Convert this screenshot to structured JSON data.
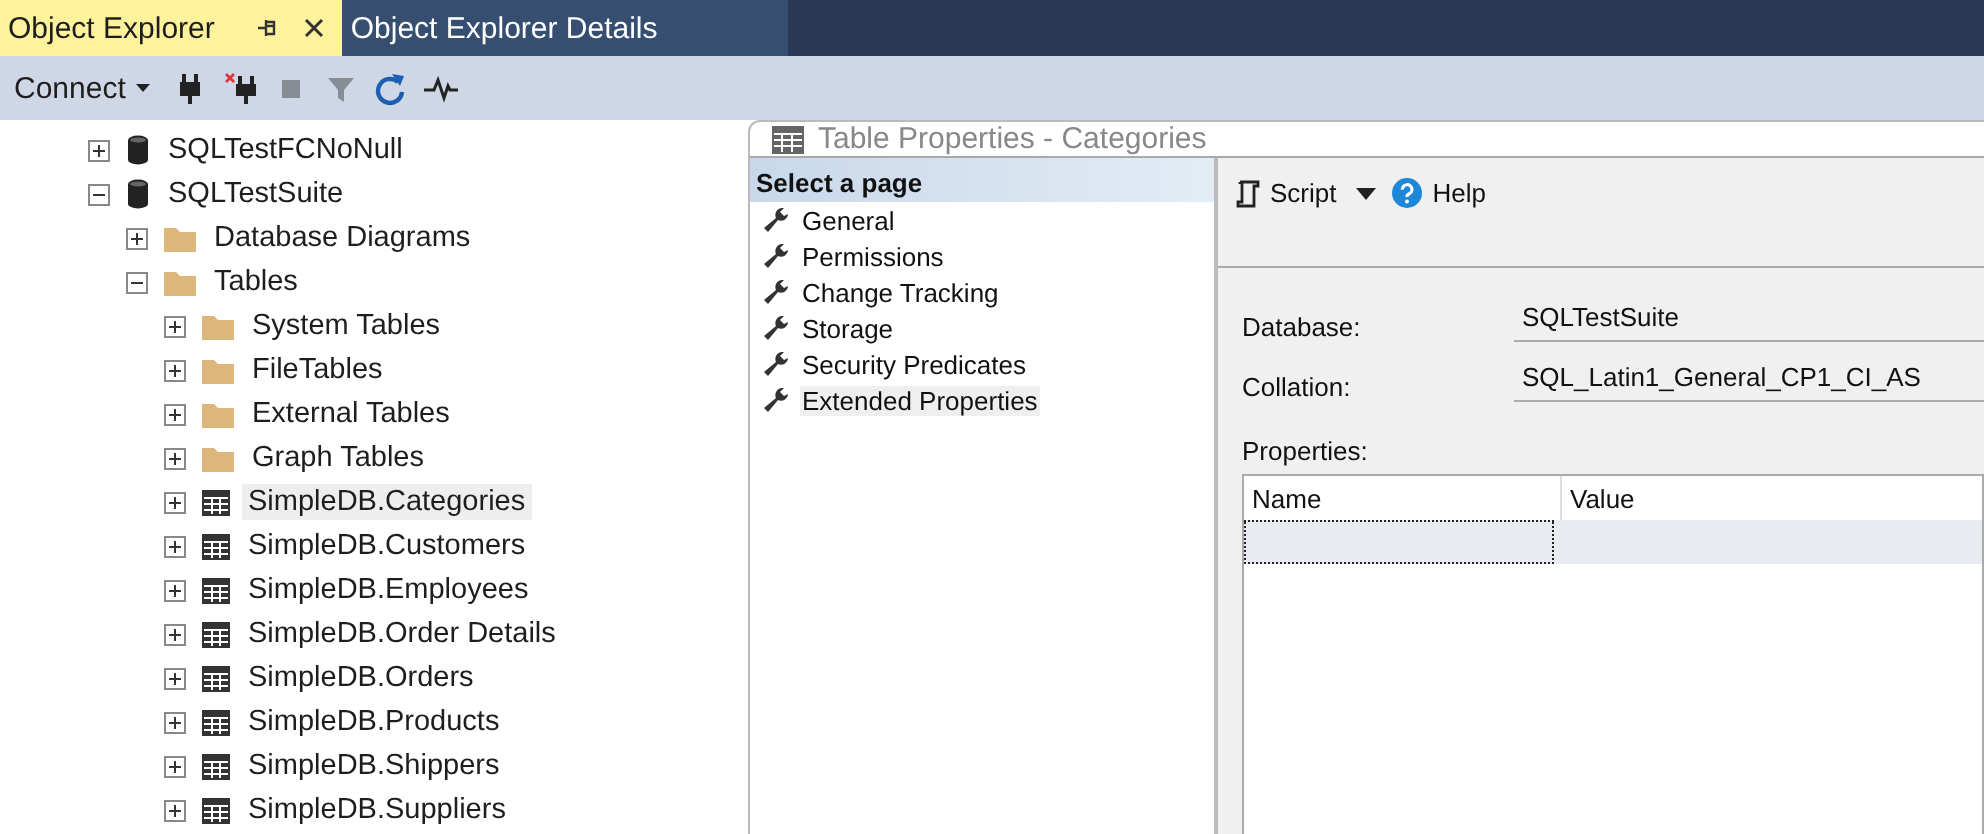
{
  "tabs": [
    {
      "label": "Object Explorer",
      "selected": true
    },
    {
      "label": "Object Explorer Details",
      "selected": false
    }
  ],
  "toolbar": {
    "connect": "Connect",
    "tools": [
      {
        "kind": "connect",
        "disabled": false
      },
      {
        "kind": "disconnect",
        "disabled": false
      },
      {
        "kind": "stop",
        "disabled": true
      },
      {
        "kind": "filter",
        "disabled": true
      },
      {
        "kind": "refresh",
        "disabled": false
      },
      {
        "kind": "activity",
        "disabled": false
      }
    ]
  },
  "tree": [
    {
      "label": "SQLTestFCNoNull",
      "kind": "database",
      "expanded": false,
      "selected": false
    },
    {
      "label": "SQLTestSuite",
      "kind": "database",
      "expanded": true,
      "selected": false,
      "children": [
        {
          "label": "Database Diagrams",
          "kind": "folder",
          "expanded": false,
          "selected": false
        },
        {
          "label": "Tables",
          "kind": "folder",
          "expanded": true,
          "selected": false,
          "children": [
            {
              "label": "System Tables",
              "kind": "folder",
              "expanded": false,
              "selected": false
            },
            {
              "label": "FileTables",
              "kind": "folder",
              "expanded": false,
              "selected": false
            },
            {
              "label": "External Tables",
              "kind": "folder",
              "expanded": false,
              "selected": false
            },
            {
              "label": "Graph Tables",
              "kind": "folder",
              "expanded": false,
              "selected": false
            },
            {
              "label": "SimpleDB.Categories",
              "kind": "table",
              "expanded": false,
              "selected": true
            },
            {
              "label": "SimpleDB.Customers",
              "kind": "table",
              "expanded": false,
              "selected": false
            },
            {
              "label": "SimpleDB.Employees",
              "kind": "table",
              "expanded": false,
              "selected": false
            },
            {
              "label": "SimpleDB.Order Details",
              "kind": "table",
              "expanded": false,
              "selected": false
            },
            {
              "label": "SimpleDB.Orders",
              "kind": "table",
              "expanded": false,
              "selected": false
            },
            {
              "label": "SimpleDB.Products",
              "kind": "table",
              "expanded": false,
              "selected": false
            },
            {
              "label": "SimpleDB.Shippers",
              "kind": "table",
              "expanded": false,
              "selected": false
            },
            {
              "label": "SimpleDB.Suppliers",
              "kind": "table",
              "expanded": false,
              "selected": false
            }
          ]
        }
      ]
    }
  ],
  "dialog": {
    "title": "Table Properties - Categories",
    "pages_header": "Select a page",
    "pages": [
      {
        "label": "General",
        "selected": false
      },
      {
        "label": "Permissions",
        "selected": false
      },
      {
        "label": "Change Tracking",
        "selected": false
      },
      {
        "label": "Storage",
        "selected": false
      },
      {
        "label": "Security Predicates",
        "selected": false
      },
      {
        "label": "Extended Properties",
        "selected": true
      }
    ],
    "script": "Script",
    "help": "Help",
    "fields": [
      {
        "label": "Database:",
        "value": "SQLTestSuite"
      },
      {
        "label": "Collation:",
        "value": "SQL_Latin1_General_CP1_CI_AS"
      }
    ],
    "properties_label": "Properties:",
    "columns": [
      "Name",
      "Value"
    ]
  }
}
